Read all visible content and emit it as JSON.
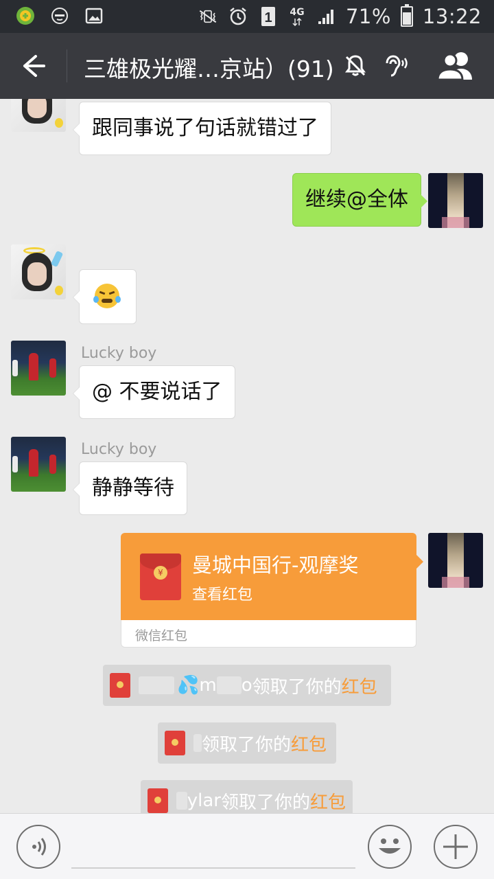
{
  "status_bar": {
    "battery_text": "71%",
    "battery_level": 0.71,
    "network": "4G",
    "sim_slot": "1",
    "time": "13:22"
  },
  "header": {
    "title": "三雄极光耀…京站）(91)"
  },
  "messages": [
    {
      "type": "text",
      "side": "left",
      "avatar": "girl",
      "text": "跟同事说了句话就错过了"
    },
    {
      "type": "text",
      "side": "right",
      "avatar": "tower",
      "text": "继续@全体"
    },
    {
      "type": "emoji",
      "side": "left",
      "avatar": "girl",
      "sender": ""
    },
    {
      "type": "text",
      "side": "left",
      "avatar": "soccer",
      "sender": "Lucky boy",
      "text": "@ 不要说话了"
    },
    {
      "type": "text",
      "side": "left",
      "avatar": "soccer",
      "sender": "Lucky boy",
      "text": "静静等待"
    }
  ],
  "red_packet": {
    "title": "曼城中国行-观摩奖",
    "action": "查看红包",
    "label": "微信红包",
    "color": "#f79c3a"
  },
  "notices": [
    {
      "name_tail": "m",
      "name_end": "o",
      "text": "领取了你的",
      "highlight": "红包"
    },
    {
      "text": "领取了你的",
      "highlight": "红包"
    },
    {
      "name_tail": "ylar",
      "text": "领取了你的",
      "highlight": "红包"
    }
  ],
  "colors": {
    "status_bar": "#292c31",
    "title_bar": "#393a3f",
    "chat_bg": "#ebebeb",
    "bubble_green": "#9fe658",
    "highlight": "#f79c3a"
  }
}
